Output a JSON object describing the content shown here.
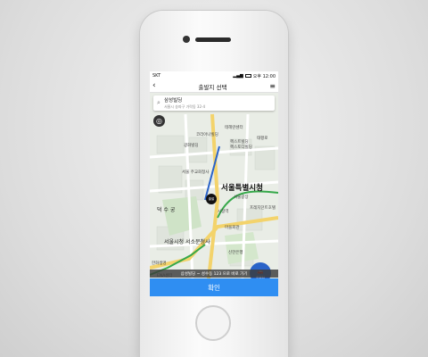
{
  "status": {
    "carrier": "SKT",
    "time": "오후 12:00"
  },
  "nav": {
    "title": "출발지 선택"
  },
  "search": {
    "title": "삼성빌딩",
    "subtitle": "서울시 송파구 가락동 32-4"
  },
  "map": {
    "labels": {
      "a": "코리아나빌딩",
      "b": "테헤란센터",
      "c": "헥스트빌딩",
      "d": "헥스토디빌딩",
      "e": "서울특별시청",
      "f": "덕 수 궁",
      "g": "서울시청 서소문청사",
      "h": "마을회관",
      "i": "신한은행",
      "j": "한화생명",
      "k": "ENA센터",
      "l": "프레지던트호텔",
      "m": "서울\n주교회청사",
      "n": "광화빌딩",
      "o": "태평로",
      "p": "시청역",
      "q": "서울광장"
    },
    "pin": "출발",
    "badge": "현위치"
  },
  "route_bar": "삼성빌딩 ~ 성수동 123 으로 바로 가기",
  "confirm": "확인"
}
